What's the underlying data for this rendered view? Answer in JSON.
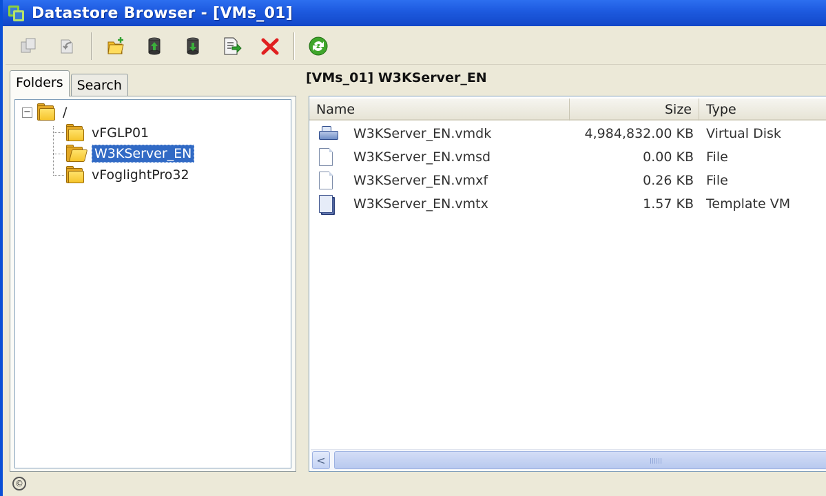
{
  "window": {
    "title": "Datastore Browser - [VMs_01]"
  },
  "toolbar": {
    "buttons": [
      {
        "icon": "copy-icon",
        "enabled": false
      },
      {
        "icon": "move-icon",
        "enabled": false
      },
      {
        "icon": "new-folder-icon",
        "enabled": true
      },
      {
        "icon": "upload-icon",
        "enabled": true
      },
      {
        "icon": "download-icon",
        "enabled": true
      },
      {
        "icon": "register-vm-icon",
        "enabled": true
      },
      {
        "icon": "delete-icon",
        "enabled": true
      },
      {
        "icon": "refresh-icon",
        "enabled": true
      }
    ]
  },
  "tabs": {
    "folders": "Folders",
    "search": "Search"
  },
  "tree": {
    "root": {
      "label": "/",
      "expander": "−"
    },
    "children": [
      {
        "label": "vFGLP01",
        "selected": false
      },
      {
        "label": "W3KServer_EN",
        "selected": true
      },
      {
        "label": "vFoglightPro32",
        "selected": false
      }
    ]
  },
  "path": "[VMs_01] W3KServer_EN",
  "table": {
    "columns": {
      "name": "Name",
      "size": "Size",
      "type": "Type"
    },
    "rows": [
      {
        "icon": "virtual-disk-icon",
        "name": "W3KServer_EN.vmdk",
        "size": "4,984,832.00 KB",
        "type": "Virtual Disk"
      },
      {
        "icon": "file-icon",
        "name": "W3KServer_EN.vmsd",
        "size": "0.00 KB",
        "type": "File"
      },
      {
        "icon": "file-icon",
        "name": "W3KServer_EN.vmxf",
        "size": "0.26 KB",
        "type": "File"
      },
      {
        "icon": "template-vm-icon",
        "name": "W3KServer_EN.vmtx",
        "size": "1.57 KB",
        "type": "Template VM"
      }
    ]
  },
  "scroll": {
    "left_arrow": "<"
  },
  "status": {
    "icon_glyph": "©"
  },
  "colors": {
    "titlebar": "#1e5be0",
    "selection": "#316ac5",
    "delete": "#e02020",
    "refresh": "#3fa62b"
  }
}
